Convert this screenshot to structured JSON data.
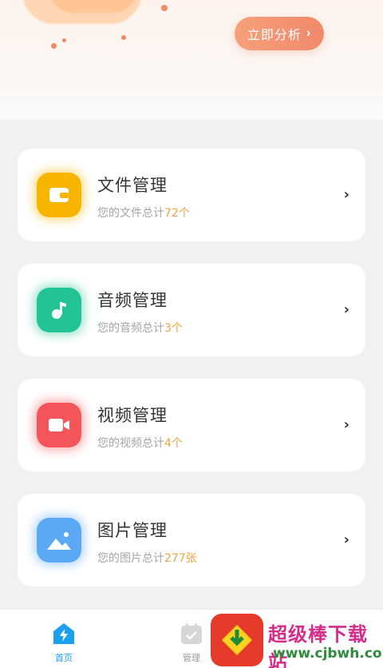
{
  "header": {
    "analyze_button": "立即分析",
    "accent_color": "#f0896a"
  },
  "categories": [
    {
      "title": "文件管理",
      "sub_prefix": "您的文件总计",
      "count": "72个",
      "icon": "wallet-icon",
      "color": "#f7b500"
    },
    {
      "title": "音频管理",
      "sub_prefix": "您的音频总计",
      "count": "3个",
      "icon": "music-note-icon",
      "color": "#22c497"
    },
    {
      "title": "视频管理",
      "sub_prefix": "您的视频总计",
      "count": "4个",
      "icon": "video-camera-icon",
      "color": "#f4555a"
    },
    {
      "title": "图片管理",
      "sub_prefix": "您的图片总计",
      "count": "277张",
      "icon": "image-icon",
      "color": "#5ba8f5"
    }
  ],
  "tabbar": {
    "items": [
      {
        "label": "首页",
        "icon": "home-lightning-icon",
        "active": true
      },
      {
        "label": "管理",
        "icon": "calendar-check-icon",
        "active": false
      }
    ],
    "active_color": "#1aa0ef"
  },
  "watermark": {
    "text": "超级棒下载站",
    "url": "www.cjbwh.com"
  }
}
